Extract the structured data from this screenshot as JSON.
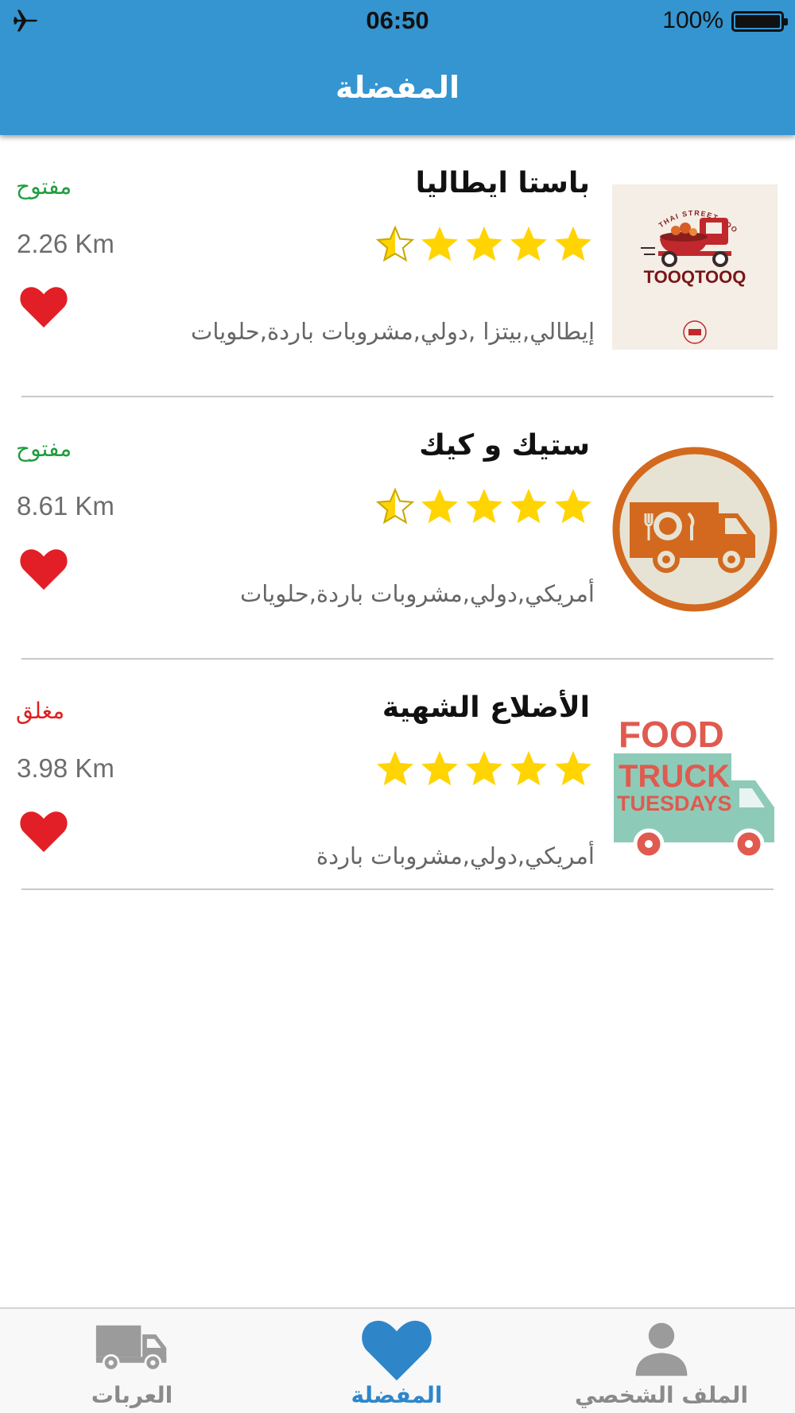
{
  "status_bar": {
    "time": "06:50",
    "battery": "100%"
  },
  "header": {
    "title": "المفضلة"
  },
  "colors": {
    "header": "#3595d0",
    "open": "#1e9e3d",
    "closed": "#e02020",
    "heart": "#e21f26",
    "star": "#ffd400",
    "active_tab": "#2e86c9"
  },
  "trucks": [
    {
      "name": "باستا ايطاليا",
      "rating": 4.5,
      "cuisines": "إيطالي,بيتزا ,دولي,مشروبات باردة,حلويات",
      "status": "مفتوح",
      "status_type": "open",
      "distance": "2.26 Km",
      "logo": "tooqtooq-logo",
      "logo_text": [
        "THAI STREET FOOD",
        "TOOQTOOQ"
      ]
    },
    {
      "name": "ستيك و كيك",
      "rating": 4.5,
      "cuisines": "أمريكي,دولي,مشروبات باردة,حلويات",
      "status": "مفتوح",
      "status_type": "open",
      "distance": "8.61 Km",
      "logo": "food-truck-circle-logo"
    },
    {
      "name": "الأضلاع الشهية",
      "rating": 5,
      "cuisines": "أمريكي,دولي,مشروبات باردة",
      "status": "مغلق",
      "status_type": "closed",
      "distance": "3.98 Km",
      "logo": "food-truck-tuesdays-logo",
      "logo_text": [
        "FOOD",
        "TRUCK",
        "TUESDAYS"
      ]
    }
  ],
  "tabs": [
    {
      "label": "العربات",
      "icon": "truck-icon",
      "active": false
    },
    {
      "label": "المفضلة",
      "icon": "heart-icon",
      "active": true
    },
    {
      "label": "الملف الشخصي",
      "icon": "person-icon",
      "active": false
    }
  ]
}
